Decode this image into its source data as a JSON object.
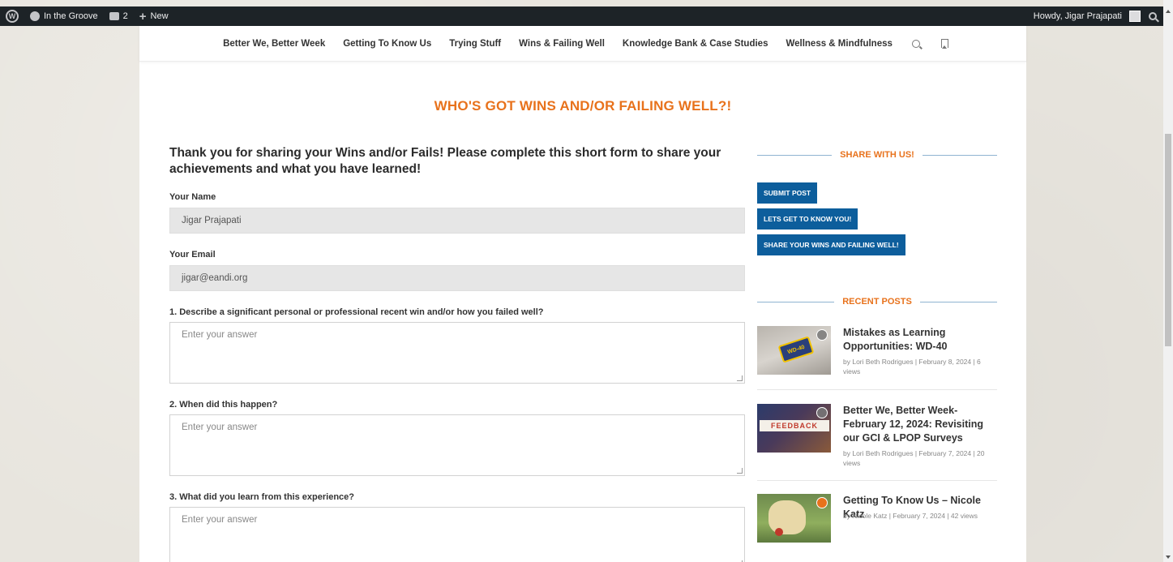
{
  "admin_bar": {
    "site_name": "In the Groove",
    "comments_count": "2",
    "new_label": "New",
    "greeting": "Howdy, Jigar Prajapati"
  },
  "nav": {
    "items": [
      "Better We, Better Week",
      "Getting To Know Us",
      "Trying Stuff",
      "Wins & Failing Well",
      "Knowledge Bank & Case Studies",
      "Wellness & Mindfulness"
    ]
  },
  "page_title": "WHO'S GOT WINS AND/OR FAILING WELL?!",
  "form": {
    "intro": "Thank you for sharing your Wins and/or Fails! Please complete this short form to share your achievements and what you have learned!",
    "name_label": "Your Name",
    "name_value": "Jigar Prajapati",
    "email_label": "Your Email",
    "email_value": "jigar@eandi.org",
    "q1_label": "1. Describe a significant personal or professional recent win and/or how you failed well?",
    "q2_label": "2. When did this happen?",
    "q3_label": "3. What did you learn from this experience?",
    "answer_placeholder": "Enter your answer"
  },
  "sidebar": {
    "share_heading": "SHARE WITH US!",
    "buttons": [
      "SUBMIT POST",
      "LETS GET TO KNOW YOU!",
      "SHARE YOUR WINS AND FAILING WELL!"
    ],
    "recent_heading": "RECENT POSTS",
    "posts": [
      {
        "title": "Mistakes as Learning Opportunities: WD-40",
        "meta": "by Lori Beth Rodrigues  |  February 8, 2024  |  6 views",
        "thumb_text": "WD-40"
      },
      {
        "title": "Better We, Better Week- February 12, 2024: Revisiting our GCI & LPOP Surveys",
        "meta": "by Lori Beth Rodrigues  |  February 7, 2024  |  20 views",
        "thumb_text": "FEEDBACK"
      },
      {
        "title": "Getting To Know Us – Nicole Katz",
        "meta": "by Nicole Katz  |  February 7, 2024  |  42 views",
        "thumb_text": ""
      }
    ]
  },
  "colors": {
    "accent_orange": "#e8721c",
    "button_blue": "#0d5e9c",
    "admin_bar": "#1d2327"
  }
}
